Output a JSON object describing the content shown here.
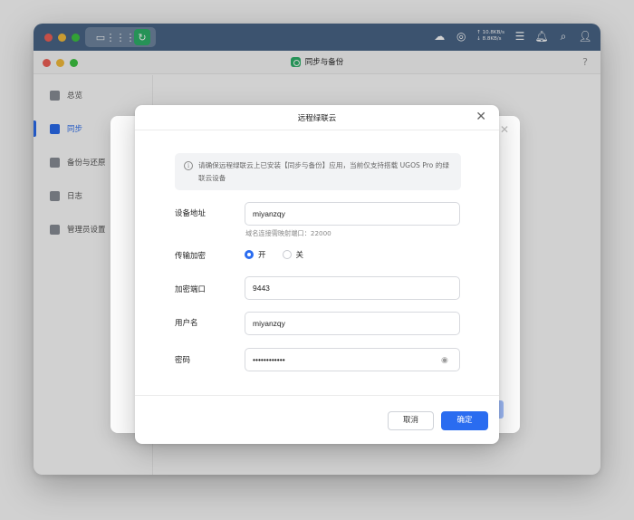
{
  "topbar": {
    "upload_speed": "10.8KB/s",
    "download_speed": "8.8KB/s",
    "icons": [
      "screen-icon",
      "grid-icon",
      "sync-app-icon",
      "cloud-icon",
      "ram-icon",
      "list-icon",
      "bell-icon",
      "search-icon",
      "user-icon"
    ]
  },
  "app": {
    "title": "同步与备份",
    "help": "?"
  },
  "sidebar": {
    "items": [
      {
        "label": "总览",
        "icon": "overview-icon"
      },
      {
        "label": "同步",
        "icon": "sync-icon",
        "active": true
      },
      {
        "label": "备份与还原",
        "icon": "backup-icon"
      },
      {
        "label": "日志",
        "icon": "log-icon"
      },
      {
        "label": "管理员设置",
        "icon": "gear-icon"
      }
    ]
  },
  "dialog": {
    "title": "远程绿联云",
    "notice": "请确保远程绿联云上已安装【同步与备份】应用，当前仅支持搭载 UGOS Pro 的绿联云设备",
    "device_address": {
      "label": "设备地址",
      "value": "miyanzqy",
      "hint": "域名连接需映射端口：22000"
    },
    "encryption": {
      "label": "传输加密",
      "on_label": "开",
      "off_label": "关",
      "selected": "on"
    },
    "encrypt_port": {
      "label": "加密端口",
      "value": "9443"
    },
    "username": {
      "label": "用户名",
      "value": "miyanzqy"
    },
    "password": {
      "label": "密码",
      "value": "••••••••••••"
    },
    "cancel_label": "取消",
    "ok_label": "确定"
  },
  "colors": {
    "accent": "#2a6cf0",
    "topbar": "#4a6688",
    "app_icon": "#2fb36b"
  }
}
